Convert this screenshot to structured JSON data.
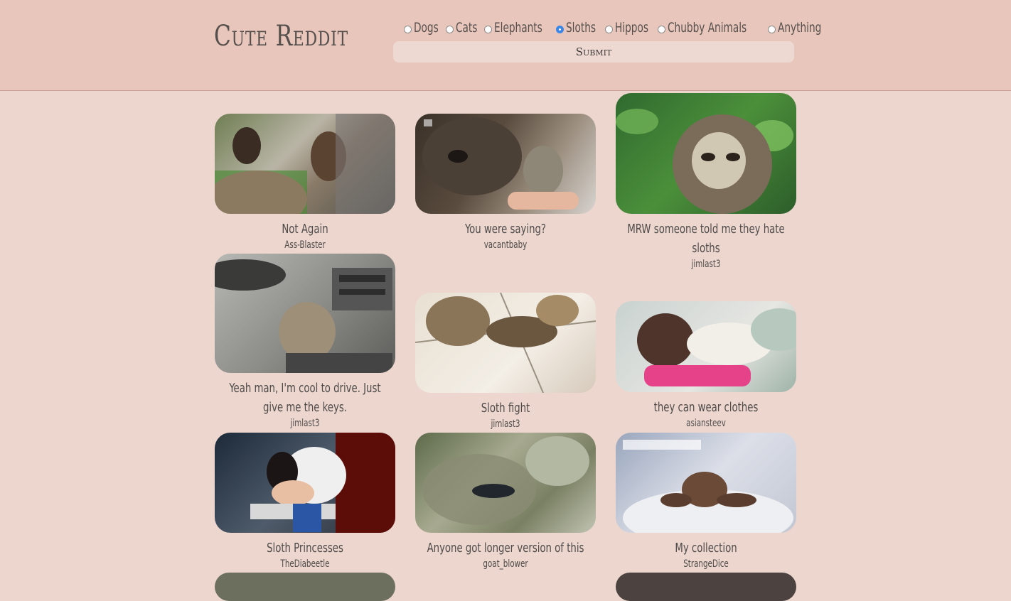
{
  "header": {
    "logo": "Cute Reddit",
    "submit_label": "Submit",
    "options": [
      {
        "label": "Dogs",
        "checked": false
      },
      {
        "label": "Cats",
        "checked": false
      },
      {
        "label": "Elephants",
        "checked": false
      },
      {
        "label": "Sloths",
        "checked": true
      },
      {
        "label": "Hippos",
        "checked": false
      },
      {
        "label": "Chubby Animals",
        "checked": false
      },
      {
        "label": "Anything",
        "checked": false
      }
    ]
  },
  "posts": [
    {
      "title": "Not Again",
      "author": "Ass-Blaster"
    },
    {
      "title": "You were saying?",
      "author": "vacantbaby"
    },
    {
      "title": "MRW someone told me they hate sloths",
      "author": "jimlast3"
    },
    {
      "title": "Yeah man, I'm cool to drive. Just give me the keys.",
      "author": "jimlast3"
    },
    {
      "title": "Sloth fight",
      "author": "jimlast3"
    },
    {
      "title": "they can wear clothes",
      "author": "asiansteev"
    },
    {
      "title": "Sloth Princesses",
      "author": "TheDiabeetle"
    },
    {
      "title": "Anyone got longer version of this",
      "author": "goat_blower"
    },
    {
      "title": "My collection",
      "author": "StrangeDice"
    }
  ]
}
